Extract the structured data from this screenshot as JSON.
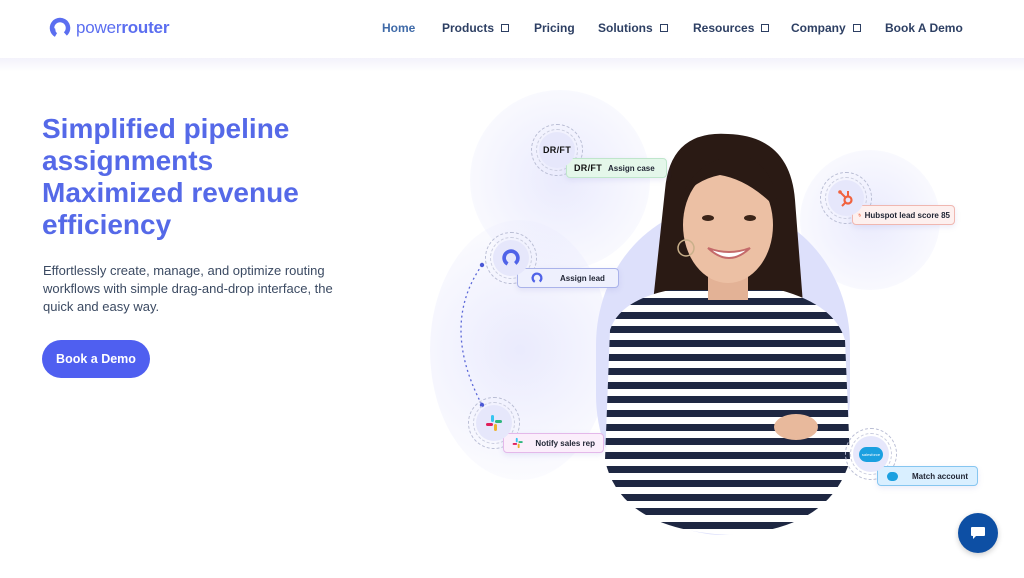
{
  "brand": {
    "name_light": "power",
    "name_bold": "router",
    "color": "#5b6ef0"
  },
  "nav": {
    "items": [
      {
        "label": "Home",
        "active": true,
        "has_dropdown": false
      },
      {
        "label": "Products",
        "active": false,
        "has_dropdown": true
      },
      {
        "label": "Pricing",
        "active": false,
        "has_dropdown": false
      },
      {
        "label": "Solutions",
        "active": false,
        "has_dropdown": true
      },
      {
        "label": "Resources",
        "active": false,
        "has_dropdown": true
      },
      {
        "label": "Company",
        "active": false,
        "has_dropdown": true
      },
      {
        "label": "Book A Demo",
        "active": false,
        "has_dropdown": false
      }
    ]
  },
  "hero": {
    "title_lines": [
      "Simplified pipeline",
      "assignments",
      "Maximized revenue",
      "efficiency"
    ],
    "subtitle": "Effortlessly create, manage, and optimize routing workflows with simple drag-and-drop interface, the quick and easy way.",
    "cta_label": "Book a Demo",
    "accent_color": "#4f5ff0"
  },
  "workflow": {
    "drift": {
      "logo_text": "DR/FT",
      "chip_label": "Assign case"
    },
    "hubspot": {
      "chip_label": "Hubspot lead score 85"
    },
    "powerrouter": {
      "chip_label": "Assign lead"
    },
    "slack": {
      "chip_label": "Notify sales rep"
    },
    "salesforce": {
      "logo_text": "salesforce",
      "chip_label": "Match account"
    }
  },
  "chat": {
    "icon": "chat-bubble-icon",
    "color": "#0d4fa4"
  }
}
